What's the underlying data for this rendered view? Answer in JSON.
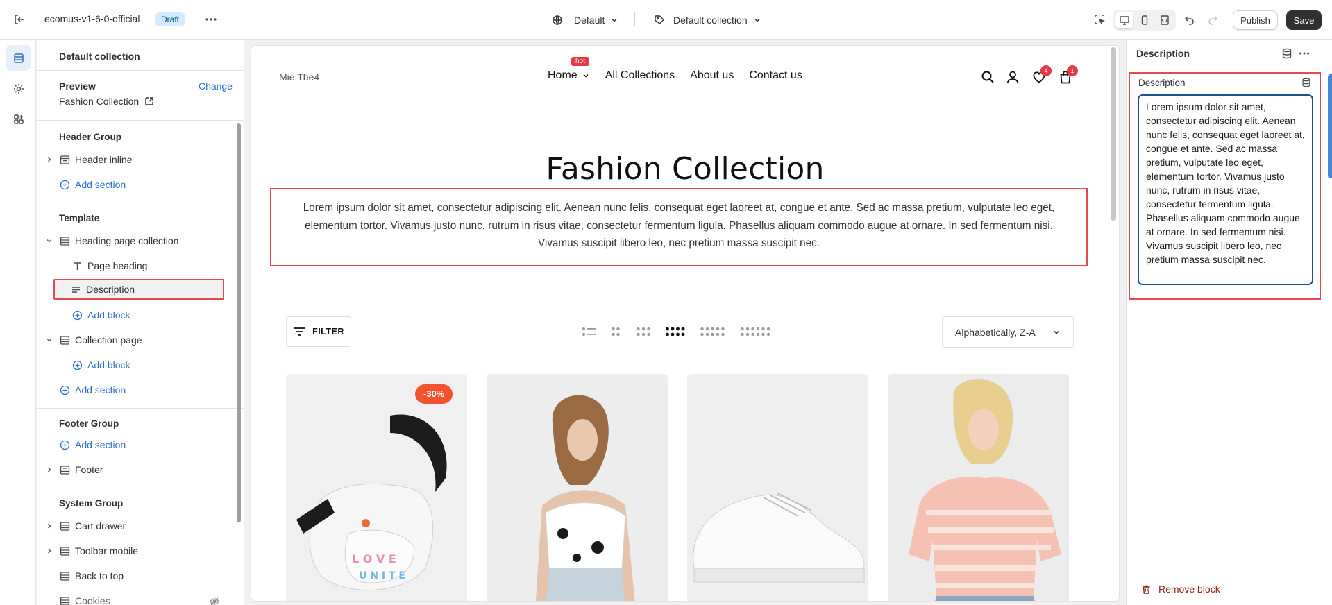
{
  "topbar": {
    "theme_name": "ecomus-v1-6-0-official",
    "status_badge": "Draft",
    "template_select": "Default",
    "collection_select": "Default collection",
    "publish_label": "Publish",
    "save_label": "Save"
  },
  "left_panel": {
    "title": "Default collection",
    "preview_label": "Preview",
    "change_label": "Change",
    "preview_value": "Fashion Collection",
    "header_group": {
      "title": "Header Group",
      "items": [
        {
          "label": "Header inline"
        }
      ],
      "add_section": "Add section"
    },
    "template": {
      "title": "Template",
      "heading_section": "Heading page collection",
      "blocks": [
        {
          "label": "Page heading"
        },
        {
          "label": "Description"
        }
      ],
      "add_block": "Add block",
      "collection_section": "Collection page",
      "add_block_2": "Add block",
      "add_section": "Add section"
    },
    "footer_group": {
      "title": "Footer Group",
      "add_section": "Add section",
      "items": [
        {
          "label": "Footer"
        }
      ]
    },
    "system_group": {
      "title": "System Group",
      "items": [
        {
          "label": "Cart drawer"
        },
        {
          "label": "Toolbar mobile"
        },
        {
          "label": "Back to top"
        },
        {
          "label": "Cookies"
        }
      ]
    }
  },
  "canvas": {
    "store_logo": "Mie The4",
    "nav": [
      {
        "label": "Home"
      },
      {
        "label": "All Collections"
      },
      {
        "label": "About us"
      },
      {
        "label": "Contact us"
      }
    ],
    "hot_badge": "hot",
    "wishlist_count": "4",
    "cart_count": "1",
    "heading": "Fashion Collection",
    "description": "Lorem ipsum dolor sit amet, consectetur adipiscing elit. Aenean nunc felis, consequat eget laoreet at, congue et ante. Sed ac massa pretium, vulputate leo eget, elementum tortor. Vivamus justo nunc, rutrum in risus vitae, consectetur fermentum ligula. Phasellus aliquam commodo augue at ornare. In sed fermentum nisi. Vivamus suscipit libero leo, nec pretium massa suscipit nec.",
    "filter_label": "FILTER",
    "sort_value": "Alphabetically, Z-A",
    "sale_badge": "-30%"
  },
  "right_panel": {
    "title": "Description",
    "field_label": "Description",
    "textarea_value": "Lorem ipsum dolor sit amet, consectetur adipiscing elit. Aenean nunc felis, consequat eget laoreet at, congue et ante. Sed ac massa pretium, vulputate leo eget, elementum tortor. Vivamus justo nunc, rutrum in risus vitae, consectetur fermentum ligula. Phasellus aliquam commodo augue at ornare. In sed fermentum nisi. Vivamus suscipit libero leo, nec pretium massa suscipit nec.",
    "remove_label": "Remove block"
  },
  "colors": {
    "accent_blue": "#2c6ecb",
    "selection_red": "#e5484d",
    "sale_orange": "#f2522e",
    "badge_red": "#e63946"
  }
}
